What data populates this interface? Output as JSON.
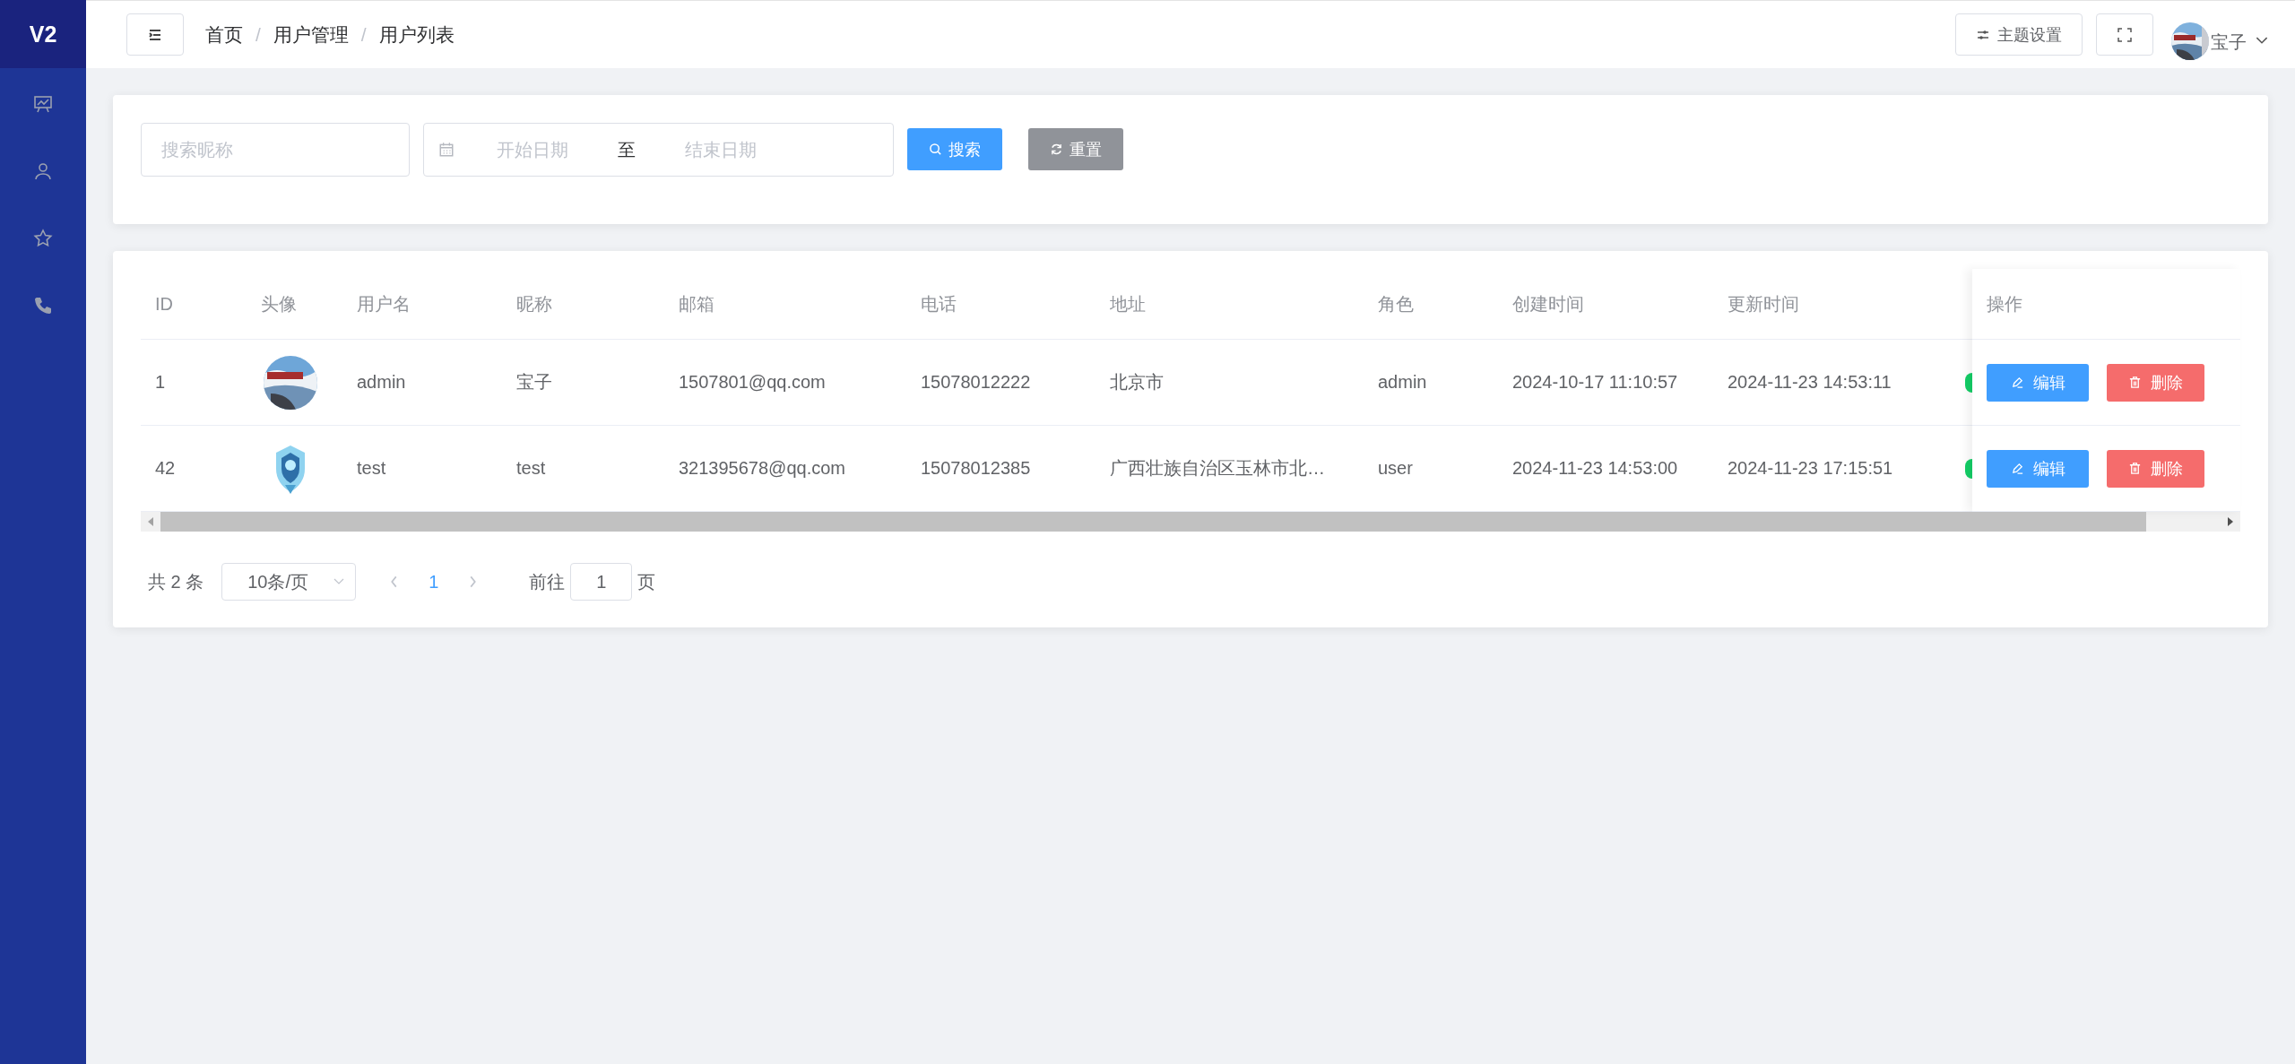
{
  "sidebar": {
    "logo": "V2"
  },
  "header": {
    "breadcrumb": [
      "首页",
      "用户管理",
      "用户列表"
    ],
    "separator": "/",
    "theme_button": "主题设置",
    "user_name": "宝子"
  },
  "search": {
    "nickname_placeholder": "搜索昵称",
    "start_placeholder": "开始日期",
    "range_separator": "至",
    "end_placeholder": "结束日期",
    "search_button": "搜索",
    "reset_button": "重置"
  },
  "table": {
    "columns": [
      "ID",
      "头像",
      "用户名",
      "昵称",
      "邮箱",
      "电话",
      "地址",
      "角色",
      "创建时间",
      "更新时间"
    ],
    "actions_column": "操作",
    "rows": [
      {
        "id": "1",
        "username": "admin",
        "nickname": "宝子",
        "email": "1507801@qq.com",
        "phone": "15078012222",
        "address": "北京市",
        "role": "admin",
        "created": "2024-10-17 11:10:57",
        "updated": "2024-11-23 14:53:11",
        "status_on": true,
        "edit": "编辑",
        "delete": "删除"
      },
      {
        "id": "42",
        "username": "test",
        "nickname": "test",
        "email": "321395678@qq.com",
        "phone": "15078012385",
        "address": "广西壮族自治区玉林市北…",
        "role": "user",
        "created": "2024-11-23 14:53:00",
        "updated": "2024-11-23 17:15:51",
        "status_on": true,
        "edit": "编辑",
        "delete": "删除"
      }
    ]
  },
  "pagination": {
    "total": "共 2 条",
    "page_size": "10条/页",
    "pages": [
      {
        "label": "1",
        "selected": true
      }
    ],
    "goto_label": "前往",
    "goto_value": "1",
    "page_suffix": "页"
  }
}
